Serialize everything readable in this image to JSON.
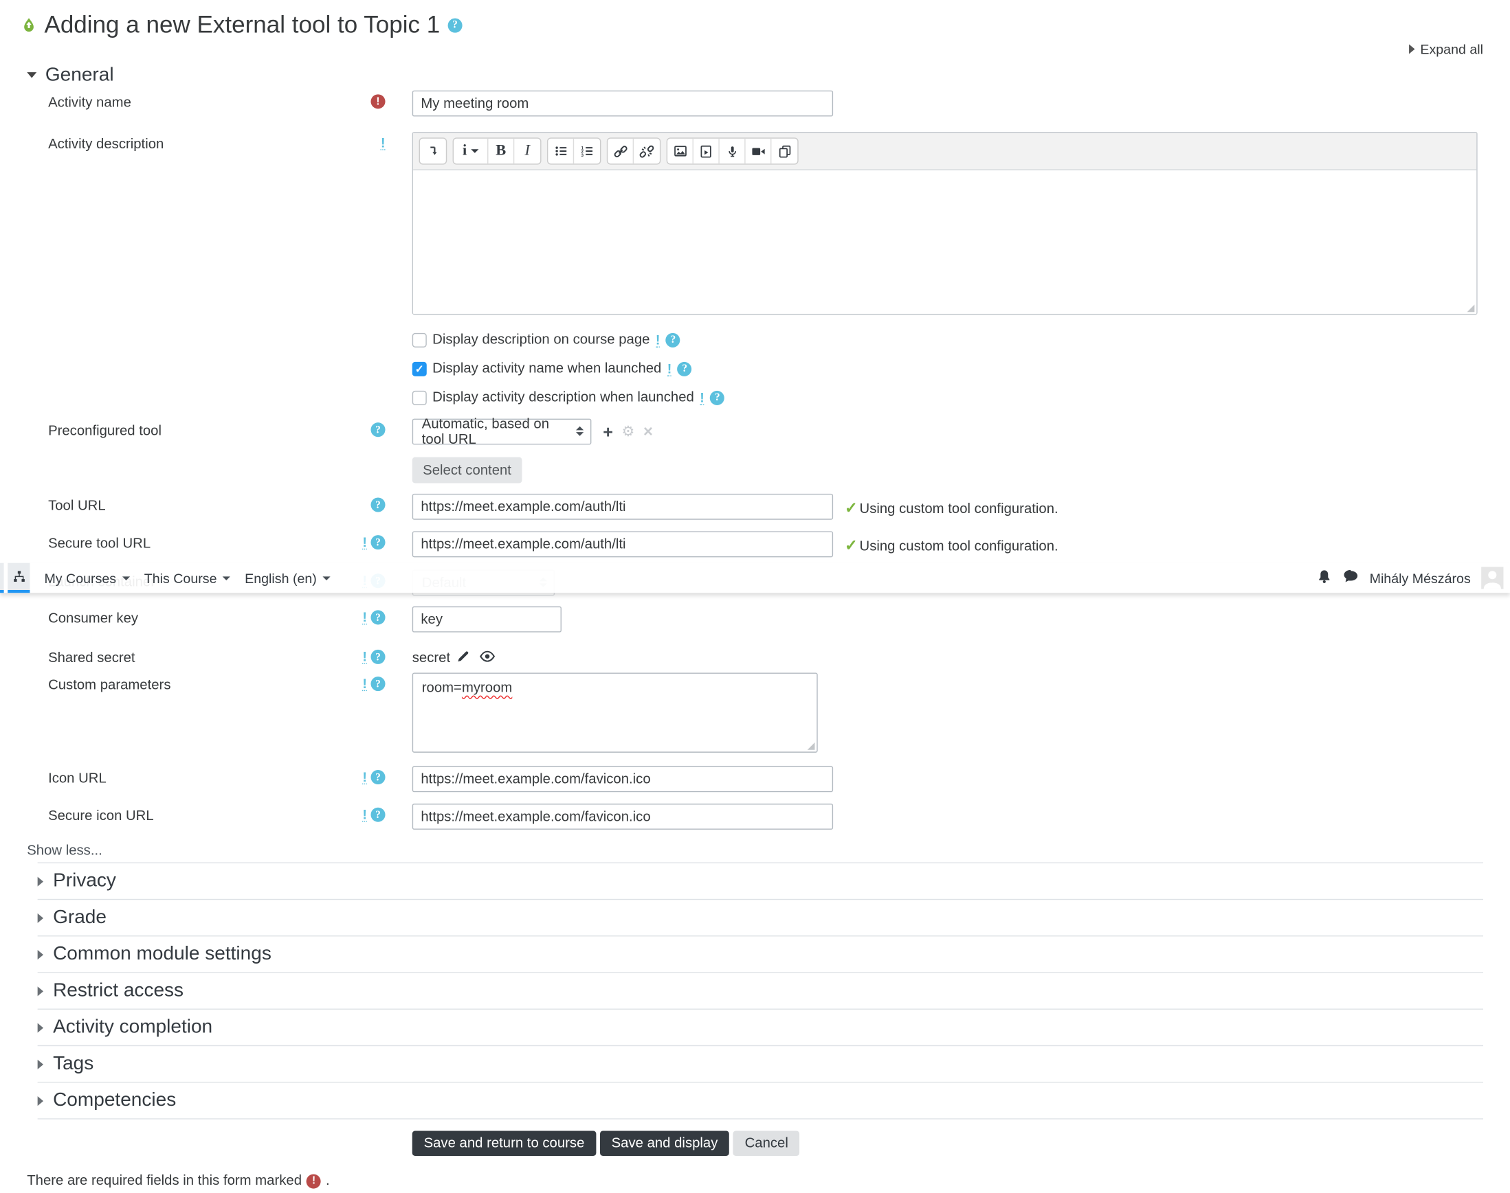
{
  "header": {
    "title": "Adding a new External tool to Topic 1",
    "expand_all": "Expand all"
  },
  "navbar": {
    "items": [
      {
        "label": "My Courses"
      },
      {
        "label": "This Course"
      },
      {
        "label": "English (en)"
      }
    ],
    "user_name": "Mihály Mészáros"
  },
  "general": {
    "heading": "General",
    "activity_name": {
      "label": "Activity name",
      "value": "My meeting room"
    },
    "activity_description": {
      "label": "Activity description"
    },
    "editor": {
      "format_label": "i",
      "bold_label": "B",
      "italic_label": "I"
    },
    "checkboxes": [
      {
        "label": "Display description on course page",
        "checked": false
      },
      {
        "label": "Display activity name when launched",
        "checked": true
      },
      {
        "label": "Display activity description when launched",
        "checked": false
      }
    ],
    "preconfigured_tool": {
      "label": "Preconfigured tool",
      "value": "Automatic, based on tool URL"
    },
    "select_content_label": "Select content",
    "tool_url": {
      "label": "Tool URL",
      "value": "https://meet.example.com/auth/lti",
      "status": "Using custom tool configuration."
    },
    "secure_tool_url": {
      "label": "Secure tool URL",
      "value": "https://meet.example.com/auth/lti",
      "status": "Using custom tool configuration."
    },
    "launch_container": {
      "label": "Launch container",
      "value": "Default"
    },
    "consumer_key": {
      "label": "Consumer key",
      "value": "key"
    },
    "shared_secret": {
      "label": "Shared secret",
      "value": "secret"
    },
    "custom_parameters": {
      "label": "Custom parameters",
      "value_prefix": "room=",
      "misspelled_word": "myroom"
    },
    "icon_url": {
      "label": "Icon URL",
      "value": "https://meet.example.com/favicon.ico"
    },
    "secure_icon_url": {
      "label": "Secure icon URL",
      "value": "https://meet.example.com/favicon.ico"
    },
    "show_less": "Show less..."
  },
  "sections": [
    {
      "label": "Privacy"
    },
    {
      "label": "Grade"
    },
    {
      "label": "Common module settings"
    },
    {
      "label": "Restrict access"
    },
    {
      "label": "Activity completion"
    },
    {
      "label": "Tags"
    },
    {
      "label": "Competencies"
    }
  ],
  "actions": {
    "save_return": "Save and return to course",
    "save_display": "Save and display",
    "cancel": "Cancel"
  },
  "footnote": {
    "text": "There are required fields in this form marked",
    "suffix": "."
  },
  "colors": {
    "help_blue": "#5bc0de",
    "required_red": "#b94a48",
    "check_green": "#7db63f",
    "checkbox_blue": "#2196f3",
    "nav_underline_blue": "#2196f3",
    "button_dark": "#343a40"
  }
}
